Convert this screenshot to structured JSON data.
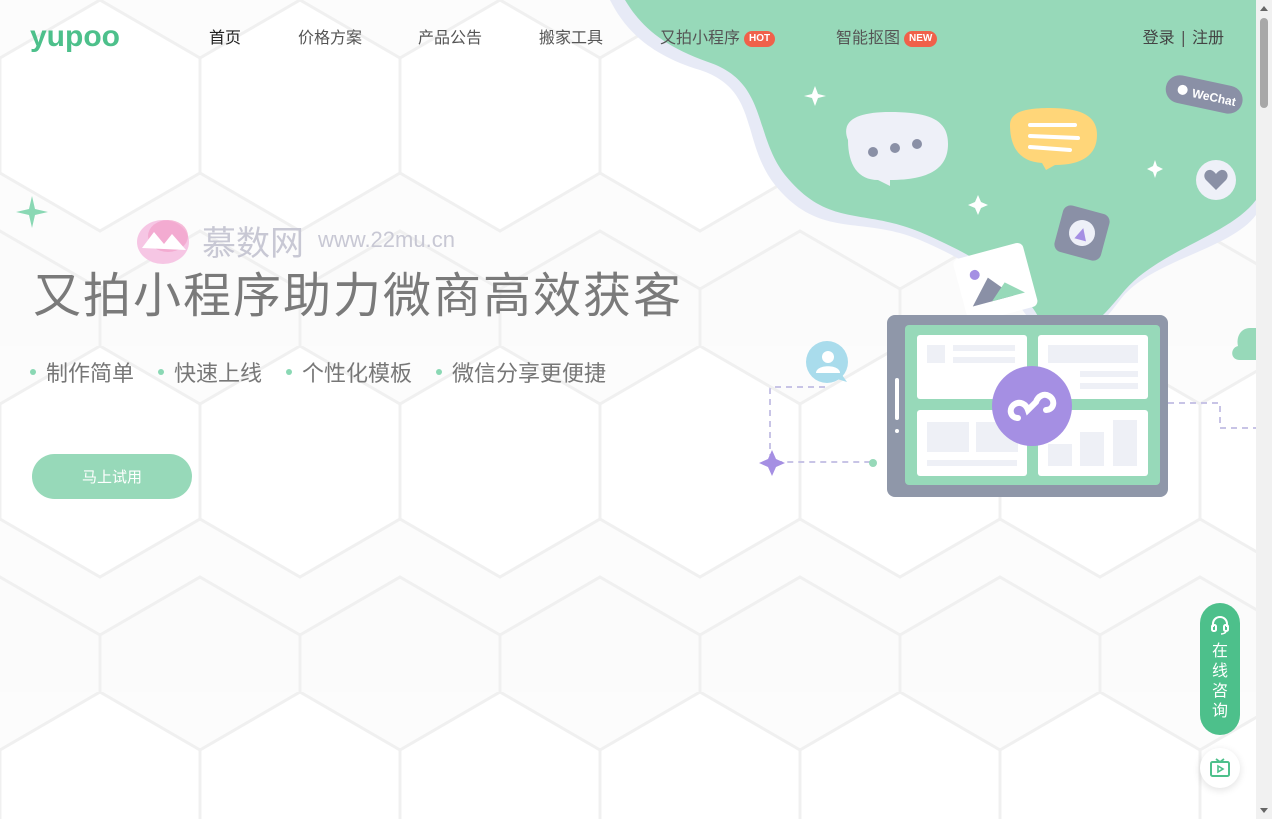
{
  "header": {
    "logo_text": "yupoo",
    "nav": [
      {
        "label": "首页",
        "active": true
      },
      {
        "label": "价格方案"
      },
      {
        "label": "产品公告"
      },
      {
        "label": "搬家工具"
      },
      {
        "label": "又拍小程序",
        "badge": "HOT"
      },
      {
        "label": "智能抠图",
        "badge": "NEW"
      }
    ],
    "login": "登录",
    "separator": "|",
    "register": "注册"
  },
  "watermark": {
    "name": "慕数网",
    "url": "www.22mu.cn"
  },
  "hero": {
    "title": "又拍小程序助力微商高效获客",
    "features": [
      "制作简单",
      "快速上线",
      "个性化模板",
      "微信分享更便捷"
    ],
    "cta": "马上试用",
    "wechat_tag": "WeChat"
  },
  "floating": {
    "consult": "在线咨询"
  },
  "colors": {
    "brand_green": "#4dc08b",
    "soft_green": "#97d9b9",
    "badge_red": "#f0614a",
    "purple": "#a58fe3"
  },
  "icons": {
    "consult": "headset-icon",
    "video": "video-play-icon",
    "hero_center": "mini-program-icon"
  }
}
